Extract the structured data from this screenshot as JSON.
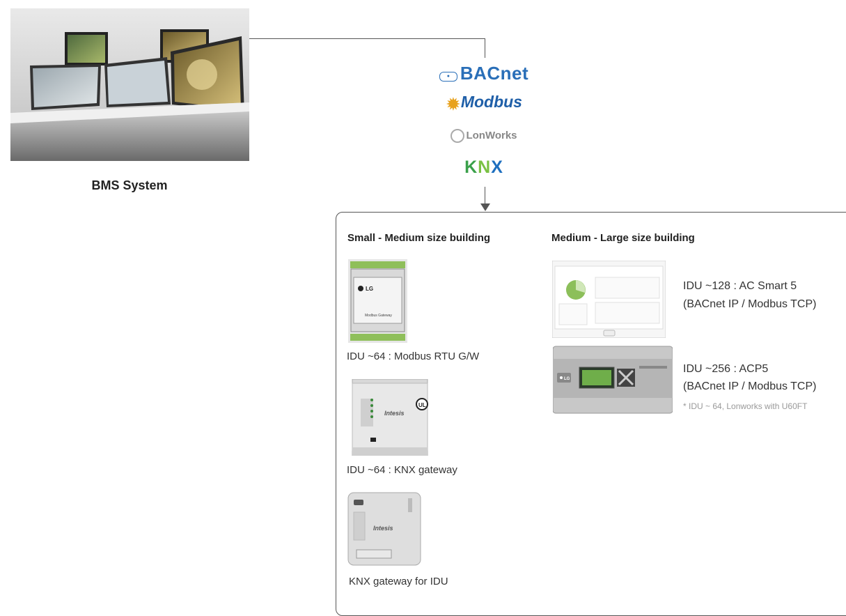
{
  "bms": {
    "label": "BMS System"
  },
  "protocols": {
    "bacnet": "BACnet",
    "modbus": "Modbus",
    "lonworks": "LonWorks",
    "knx": {
      "k": "K",
      "n": "N",
      "x": "X"
    }
  },
  "small_medium": {
    "heading": "Small - Medium size building",
    "items": [
      {
        "caption": "IDU ~64 : Modbus RTU G/W",
        "device_brand": "LG",
        "device_text": "Modbus Gateway"
      },
      {
        "caption": "IDU ~64 : KNX gateway",
        "device_brand": "Intesis",
        "device_badge": "UL"
      },
      {
        "caption": "KNX gateway for IDU",
        "device_brand": "Intesis"
      }
    ]
  },
  "medium_large": {
    "heading": "Medium - Large size building",
    "items": [
      {
        "line1": "IDU ~128 : AC Smart 5",
        "line2": "(BACnet IP / Modbus TCP)"
      },
      {
        "line1": "IDU ~256 : ACP5",
        "line2": "(BACnet IP / Modbus TCP)",
        "note": "* IDU ~ 64, Lonworks with U60FT",
        "device_brand": "LG"
      }
    ]
  },
  "colors": {
    "line": "#555555",
    "bacnet": "#2a6fb8",
    "modbus": "#1f5fa8",
    "knx_k": "#3aa04a",
    "knx_n": "#7ac143",
    "knx_x": "#1e6fbf"
  }
}
